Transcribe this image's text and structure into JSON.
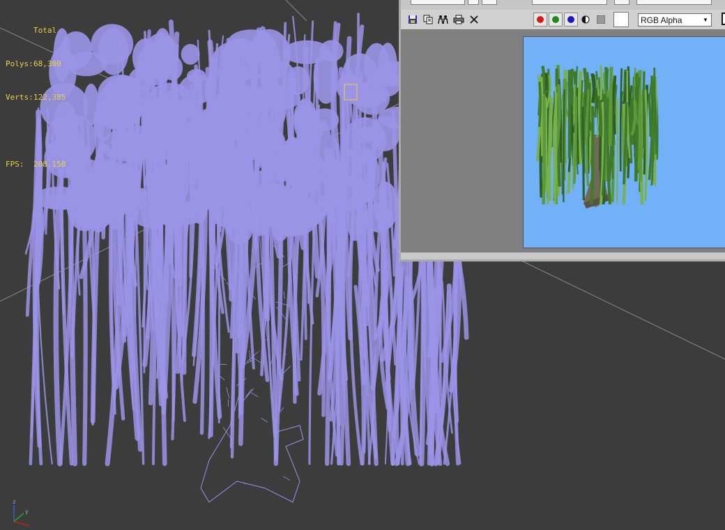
{
  "viewport": {
    "stats": {
      "header": "Total",
      "polys_label": "Polys:",
      "polys_value": "68,300",
      "verts_label": "Verts:",
      "verts_value": "122,385",
      "fps_label": "FPS:",
      "fps_value": "208.158"
    },
    "colors": {
      "background": "#3c3c3c",
      "wireframe": "#9b93e6",
      "stats_text": "#e8d24a"
    },
    "axis_gizmo": {
      "z": "z",
      "y": "y",
      "x": "x"
    }
  },
  "frame_buffer": {
    "toolbar": {
      "save_icon": "save-icon",
      "clone_icon": "clone-icon",
      "copy_icon": "copy-icon",
      "print_icon": "print-icon",
      "clear_icon": "clear-icon",
      "channels": [
        {
          "name": "red",
          "color": "#d11a1a"
        },
        {
          "name": "green",
          "color": "#1e8a1e"
        },
        {
          "name": "blue",
          "color": "#1a1ab8"
        }
      ],
      "channel_select": "RGB Alpha"
    },
    "render_background": "#72b1f7"
  }
}
